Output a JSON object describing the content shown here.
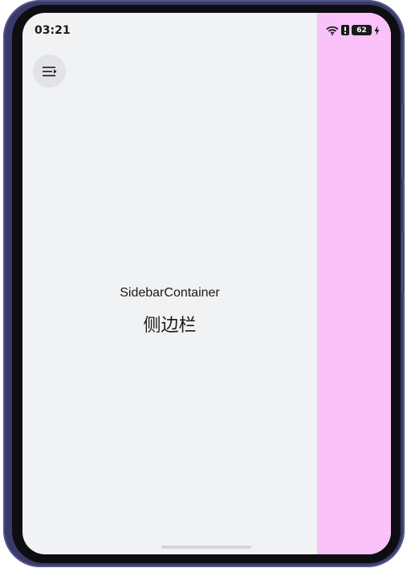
{
  "status_bar": {
    "time": "03:21",
    "battery_level": "62",
    "icons": [
      "wifi-icon",
      "alert-icon",
      "battery-icon",
      "charging-icon"
    ]
  },
  "toolbar": {
    "menu_icon": "sidebar-toggle-icon"
  },
  "content": {
    "title": "SidebarContainer",
    "subtitle": "侧边栏"
  },
  "colors": {
    "sidebar_panel": "#f9c2f9",
    "screen_background": "#f1f2f4",
    "device_frame": "#3a3a6a"
  }
}
